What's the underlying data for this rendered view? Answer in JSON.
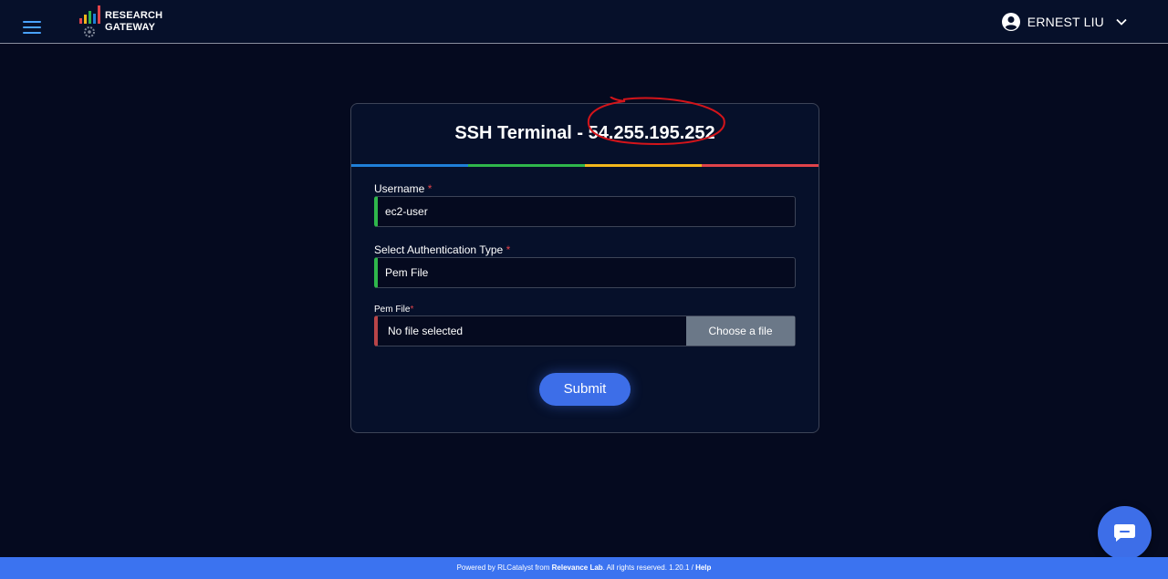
{
  "header": {
    "logo_line1": "RESEARCH",
    "logo_line2": "GATEWAY",
    "user_name": "ERNEST LIU"
  },
  "card": {
    "title_prefix": "SSH Terminal - ",
    "ip": "54.255.195.252",
    "rainbow_colors": [
      "#1f7fd8",
      "#2fb74b",
      "#f2b71b",
      "#e0434a"
    ]
  },
  "form": {
    "username_label": "Username",
    "username_value": "ec2-user",
    "auth_label": "Select Authentication Type",
    "auth_value": "Pem File",
    "pem_label": "Pem File",
    "required_mark": "*",
    "file_status": "No file selected",
    "file_button": "Choose a file",
    "submit_label": "Submit"
  },
  "footer": {
    "prefix": "Powered by RLCatalyst from ",
    "company": "Relevance Lab",
    "rights": ". All rights reserved. 1.20.1 / ",
    "help": "Help"
  },
  "icons": {
    "menu": "hamburger-icon",
    "user": "user-circle-icon",
    "chevron": "chevron-down-icon",
    "chat": "chat-icon"
  },
  "colors": {
    "background": "#050a1f",
    "accent": "#3d6ee8",
    "valid_border": "#2fb74b",
    "invalid_border": "#b84448",
    "annotation": "#d4141a"
  }
}
